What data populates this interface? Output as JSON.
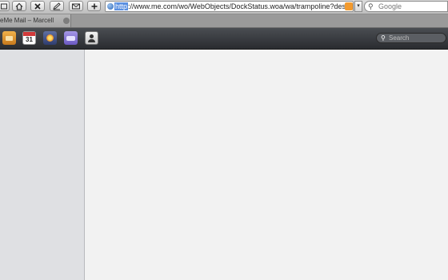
{
  "toolbar": {
    "buttons": [
      {
        "name": "window-button",
        "icon": "window-icon"
      },
      {
        "name": "home-button",
        "icon": "home-icon"
      },
      {
        "name": "stop-button",
        "icon": "close-icon"
      },
      {
        "name": "edit-button",
        "icon": "pencil-icon"
      },
      {
        "name": "mail-button",
        "icon": "envelope-icon"
      },
      {
        "name": "add-bookmark-button",
        "icon": "plus-icon"
      }
    ],
    "url_scheme": "http",
    "url_rest": "://www.me.com/wo/WebObjects/DockStatus.woa/wa/trampoline?destir",
    "search_placeholder": "Google"
  },
  "tab": {
    "label": "eMe Mail – Marcell"
  },
  "appbar": {
    "apps": [
      "mail",
      "calendar",
      "gallery",
      "idisk",
      "contacts"
    ],
    "calendar_number": "31",
    "search_placeholder": "Search"
  },
  "colors": {
    "appbar": "#2f3135",
    "sidebar": "#dfe0e3",
    "main": "#f2f2f2",
    "url_highlight": "#5a8fe0"
  }
}
